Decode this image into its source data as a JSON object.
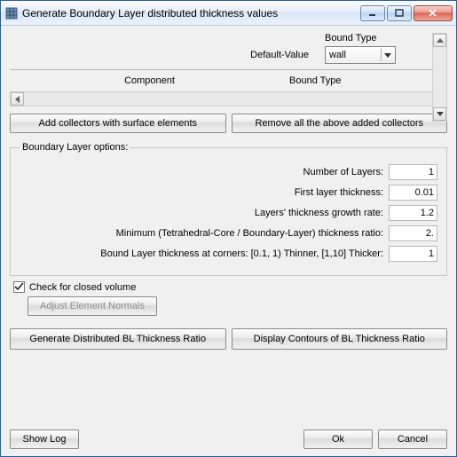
{
  "title": "Generate Boundary Layer distributed thickness values",
  "section1": {
    "bound_type_header": "Bound Type",
    "default_value_label": "Default-Value",
    "combo_value": "wall",
    "col_component": "Component",
    "col_bound_type": "Bound Type"
  },
  "buttons": {
    "add_collectors": "Add collectors with surface elements",
    "remove_collectors": "Remove all the above added collectors",
    "adjust_normals": "Adjust Element Normals",
    "gen_ratio": "Generate Distributed BL Thickness Ratio",
    "disp_contours": "Display Contours of BL Thickness Ratio",
    "show_log": "Show Log",
    "ok": "Ok",
    "cancel": "Cancel"
  },
  "fieldset": {
    "legend": "Boundary Layer options:",
    "num_layers_label": "Number of Layers:",
    "num_layers": "1",
    "first_thickness_label": "First layer thickness:",
    "first_thickness": "0.01",
    "growth_label": "Layers' thickness growth rate:",
    "growth": "1.2",
    "min_ratio_label": "Minimum (Tetrahedral-Core / Boundary-Layer) thickness ratio:",
    "min_ratio": "2.",
    "corners_label": "Bound Layer thickness at corners: [0.1, 1) Thinner, [1,10] Thicker:",
    "corners": "1"
  },
  "check_closed": "Check for closed volume"
}
